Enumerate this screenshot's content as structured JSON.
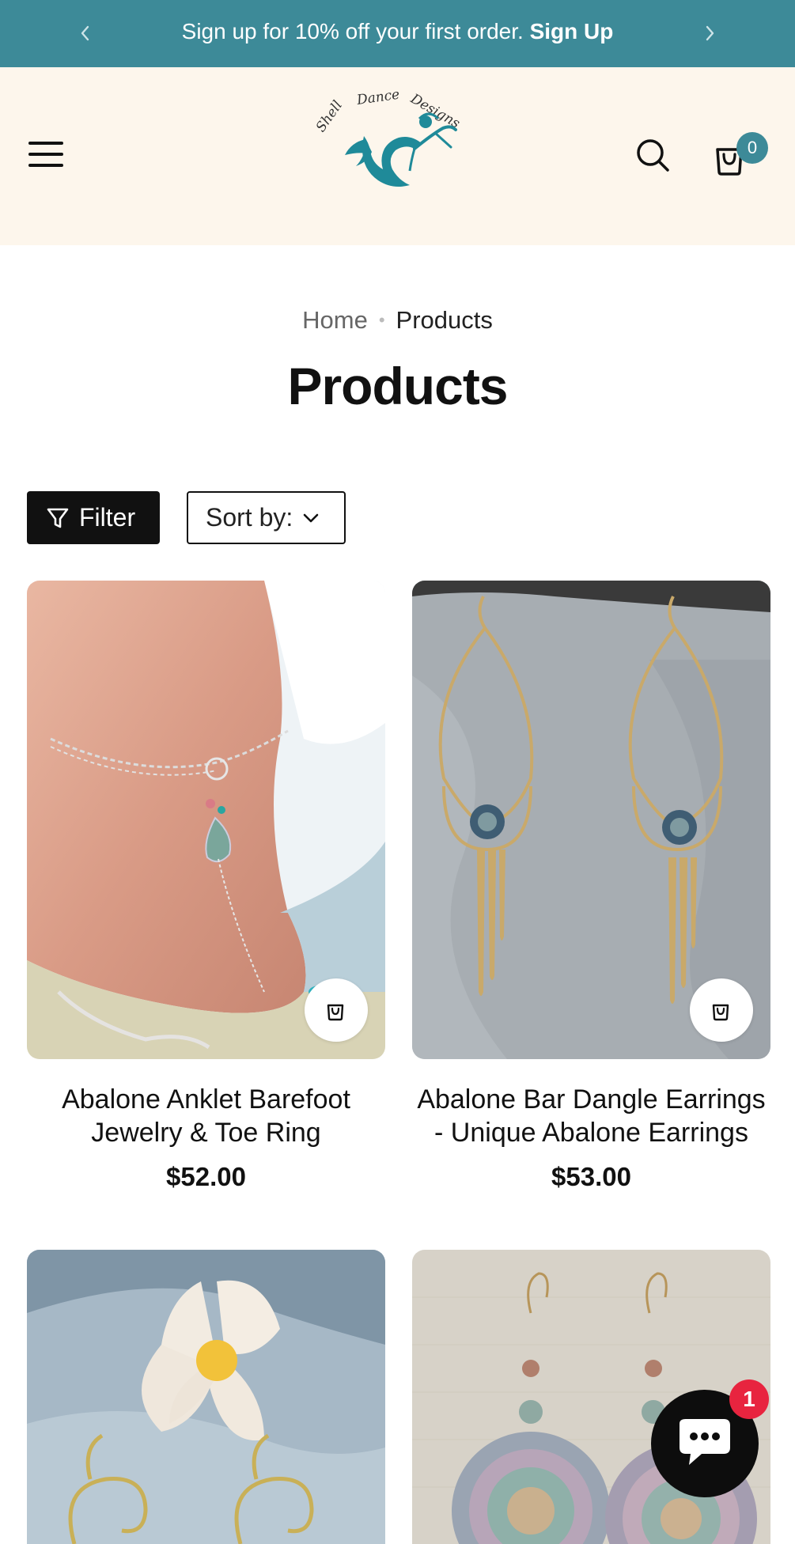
{
  "announcement": {
    "text": "Sign up for 10% off your first order.",
    "link": "Sign Up",
    "prev_icon": "chevron-left-icon",
    "next_icon": "chevron-right-icon"
  },
  "header": {
    "logo_text": "Shell Dance Designs",
    "menu_icon": "hamburger-menu-icon",
    "search_icon": "search-icon",
    "cart_icon": "shopping-bag-icon",
    "cart_count": "0"
  },
  "breadcrumb": {
    "home": "Home",
    "separator": "•",
    "current": "Products"
  },
  "page_title": "Products",
  "toolbar": {
    "filter_label": "Filter",
    "sort_label": "Sort by:"
  },
  "products": [
    {
      "title": "Abalone Anklet Barefoot Jewelry & Toe Ring",
      "price": "$52.00"
    },
    {
      "title": "Abalone Bar Dangle Earrings - Unique Abalone Earrings",
      "price": "$53.00"
    },
    {
      "title": "",
      "price": ""
    },
    {
      "title": "",
      "price": ""
    }
  ],
  "chat": {
    "badge_count": "1"
  },
  "colors": {
    "brand_teal": "#3d8a98",
    "header_bg": "#fdf6ec",
    "badge_red": "#e8243f"
  }
}
